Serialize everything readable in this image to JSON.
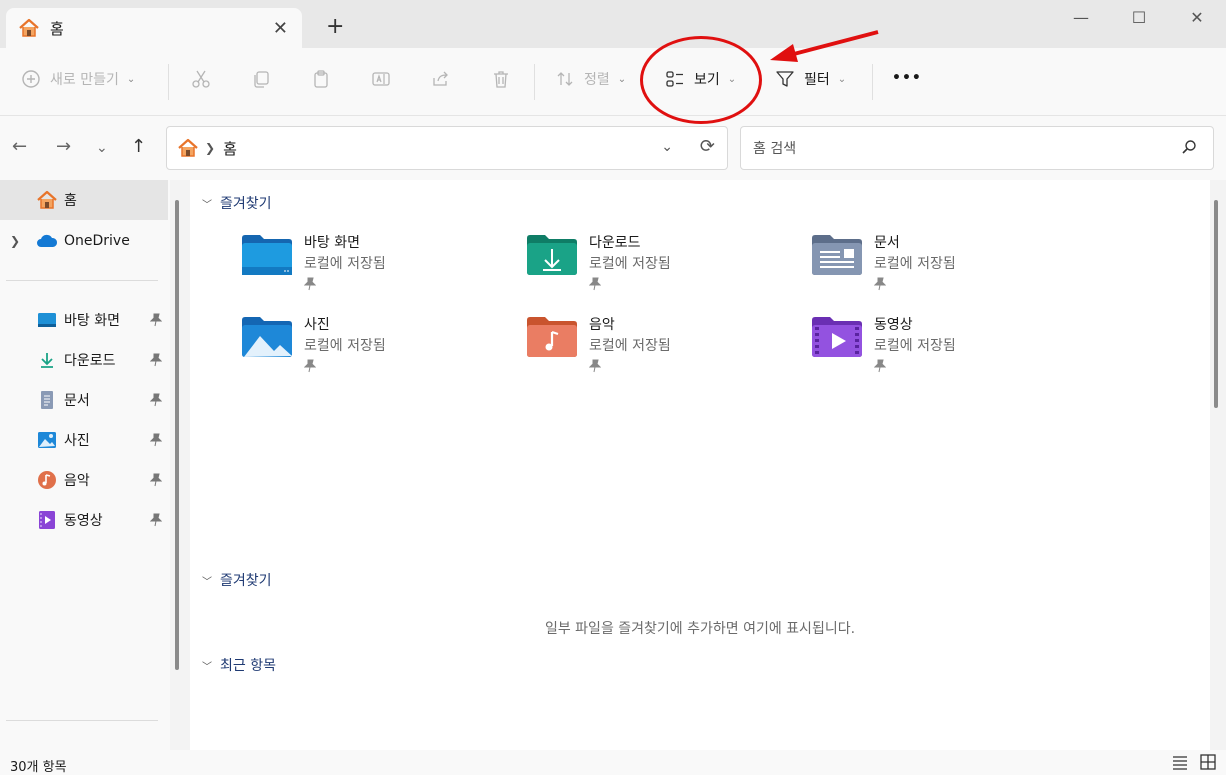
{
  "tab": {
    "title": "홈",
    "close": "✕",
    "new_tab": "+"
  },
  "window_controls": {
    "minimize": "—",
    "maximize": "☐",
    "close": "✕"
  },
  "toolbar": {
    "new_label": "새로 만들기",
    "sort_label": "정렬",
    "view_label": "보기",
    "filter_label": "필터",
    "more_label": "•••"
  },
  "address": {
    "location": "홈",
    "search_placeholder": "홈 검색"
  },
  "sidebar": {
    "home": "홈",
    "onedrive": "OneDrive",
    "items": [
      {
        "label": "바탕 화면",
        "icon": "desktop-icon"
      },
      {
        "label": "다운로드",
        "icon": "download-icon"
      },
      {
        "label": "문서",
        "icon": "document-icon"
      },
      {
        "label": "사진",
        "icon": "picture-icon"
      },
      {
        "label": "음악",
        "icon": "music-icon"
      },
      {
        "label": "동영상",
        "icon": "video-icon"
      }
    ]
  },
  "sections": {
    "quick_access": "즐겨찾기",
    "favorites": "즐겨찾기",
    "recent": "최근 항목"
  },
  "folders": [
    {
      "name": "바탕 화면",
      "sub": "로컬에 저장됨",
      "color": "#1e90d6"
    },
    {
      "name": "다운로드",
      "sub": "로컬에 저장됨",
      "color": "#1aa387"
    },
    {
      "name": "문서",
      "sub": "로컬에 저장됨",
      "color": "#7d8ea8"
    },
    {
      "name": "사진",
      "sub": "로컬에 저장됨",
      "color": "#1e88d8"
    },
    {
      "name": "음악",
      "sub": "로컬에 저장됨",
      "color": "#e0704a"
    },
    {
      "name": "동영상",
      "sub": "로컬에 저장됨",
      "color": "#8a44d6"
    }
  ],
  "empty_message": "일부 파일을 즐겨찾기에 추가하면 여기에 표시됩니다.",
  "status": {
    "count": "30개 항목"
  },
  "colors": {
    "accent": "#0067c0",
    "annotation": "#e01010"
  }
}
